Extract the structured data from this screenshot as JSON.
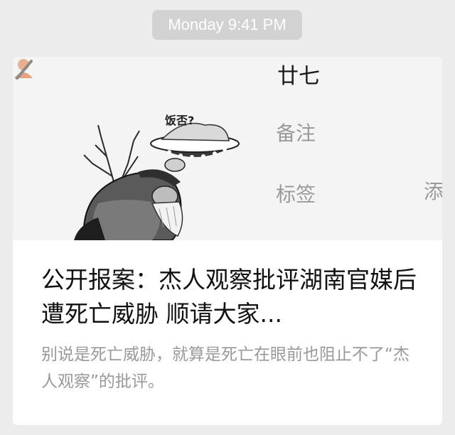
{
  "timestamp": "Monday 9:41 PM",
  "article": {
    "title": "公开报案：杰人观察批评湖南官媒后遭死亡威胁 顺请大家...",
    "summary": "别说是死亡威胁，就算是死亡在眼前也阻止不了“杰人观察”的批评。"
  },
  "cover": {
    "profile_name": "廿七",
    "remark_label": "备注",
    "tags_label": "标签",
    "add_label": "添",
    "bowl_caption": "饭否?"
  }
}
